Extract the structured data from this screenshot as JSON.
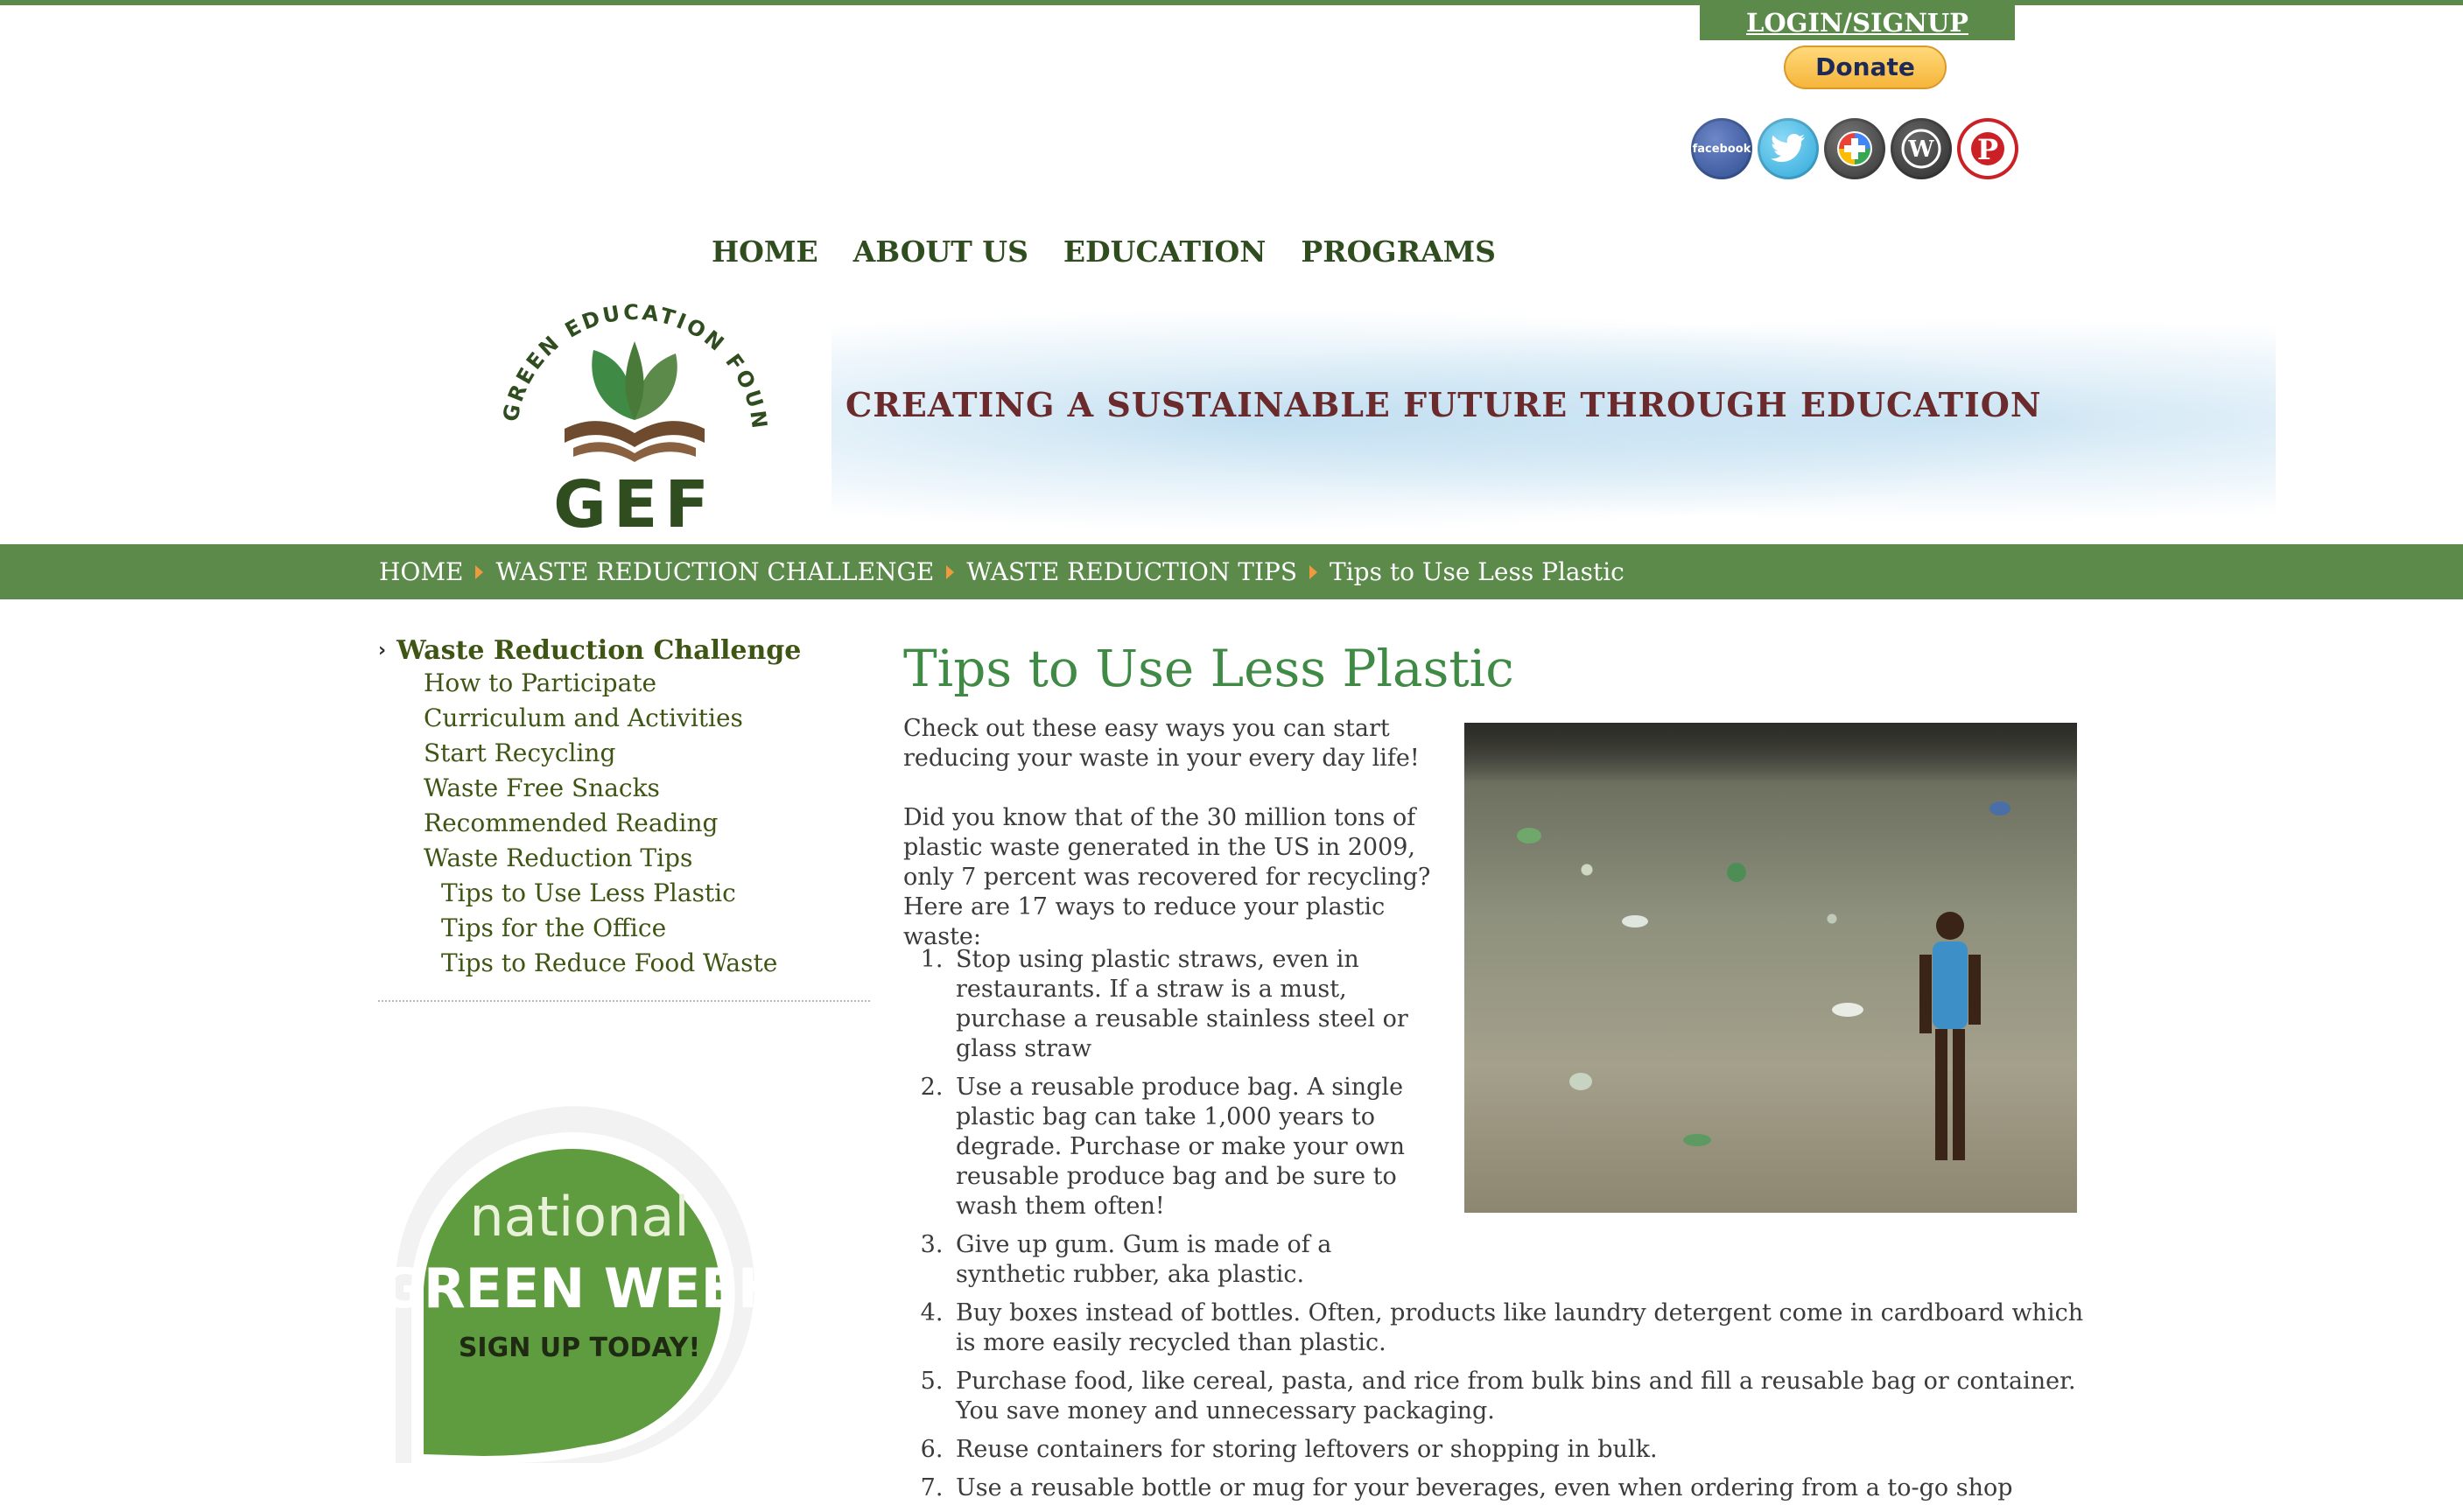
{
  "header": {
    "login_label": "LOGIN/SIGNUP",
    "donate_label": "Donate",
    "social": [
      {
        "icon": "facebook-icon",
        "label": "facebook"
      },
      {
        "icon": "twitter-icon",
        "label": ""
      },
      {
        "icon": "google-plus-icon",
        "label": ""
      },
      {
        "icon": "wordpress-icon",
        "label": ""
      },
      {
        "icon": "pinterest-icon",
        "label": ""
      }
    ]
  },
  "nav": {
    "items": [
      "HOME",
      "ABOUT US",
      "EDUCATION",
      "PROGRAMS"
    ]
  },
  "banner": {
    "logo_arc_text": "GREEN EDUCATION FOUNDATION",
    "logo_letters": "GEF",
    "tagline": "CREATING A SUSTAINABLE FUTURE THROUGH EDUCATION"
  },
  "breadcrumb": {
    "items": [
      "HOME",
      "WASTE REDUCTION CHALLENGE",
      "WASTE REDUCTION TIPS"
    ],
    "current": "Tips to Use Less Plastic"
  },
  "sidebar": {
    "heading": "Waste Reduction Challenge",
    "items": [
      "How to Participate",
      "Curriculum and Activities",
      "Start Recycling",
      "Waste Free Snacks",
      "Recommended Reading",
      "Waste Reduction Tips"
    ],
    "subitems": [
      "Tips to Use Less Plastic",
      "Tips for the Office",
      "Tips to Reduce Food Waste"
    ],
    "badge": {
      "line1": "national",
      "line2": "GREEN WEEK",
      "line3": "SIGN UP TODAY!"
    }
  },
  "content": {
    "title": "Tips to Use Less Plastic",
    "intro": "Check out these easy ways you can start reducing your waste in your every day life!",
    "fact": "Did you know that of the 30 million tons of plastic waste generated in the US in 2009, only 7 percent was recovered for recycling? Here are 17 ways to reduce your plastic waste:",
    "tips": [
      " Stop using plastic straws, even in restaurants. If a straw is a must, purchase a reusable stainless steel or glass straw",
      "Use a reusable produce bag. A single plastic bag can take 1,000 years to degrade. Purchase or make your own reusable produce bag and be sure to wash them often!",
      "Give up gum. Gum is made of a synthetic rubber, aka plastic.",
      "Buy boxes instead of bottles. Often, products like laundry detergent come in cardboard which is more easily recycled than plastic.",
      "Purchase food, like cereal, pasta, and rice from bulk bins and fill a reusable bag or container. You save money and unnecessary packaging.",
      "Reuse containers for storing leftovers or shopping in bulk.",
      "Use a reusable bottle or mug for your beverages, even when ordering from a to-go shop"
    ]
  },
  "colors": {
    "brand_green": "#5b8a4a",
    "title_green": "#3f8a44",
    "link_green": "#3e5513",
    "tagline_red": "#6b2a2b",
    "crumb_arrow": "#f09a3e"
  }
}
